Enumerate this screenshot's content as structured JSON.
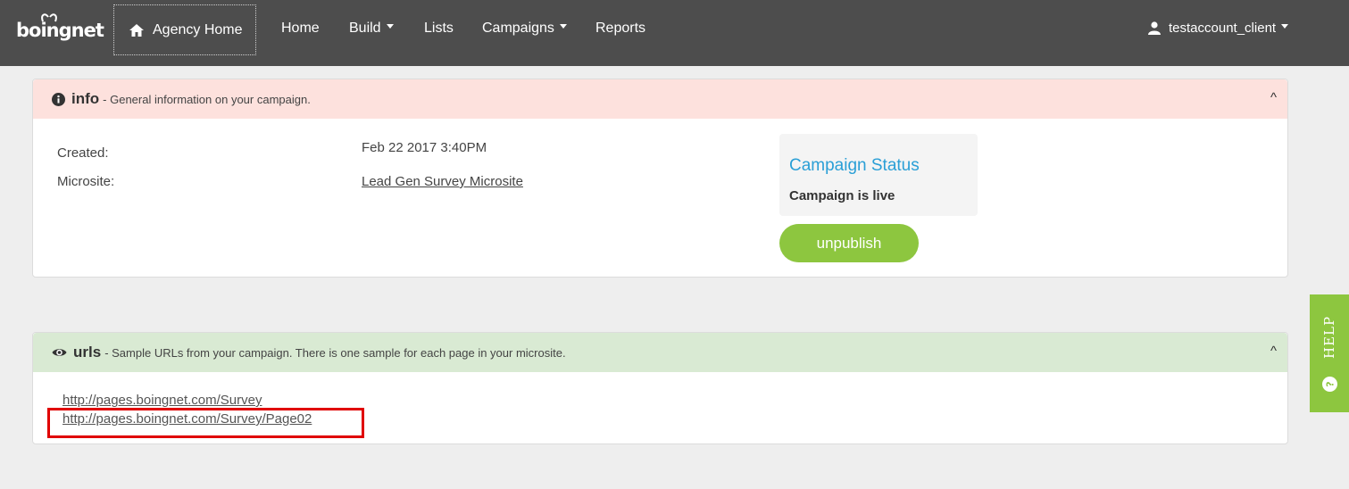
{
  "header": {
    "logo_text": "boingnet",
    "agency_home": "Agency Home",
    "nav": [
      {
        "label": "Home",
        "dropdown": false
      },
      {
        "label": "Build",
        "dropdown": true
      },
      {
        "label": "Lists",
        "dropdown": false
      },
      {
        "label": "Campaigns",
        "dropdown": true
      },
      {
        "label": "Reports",
        "dropdown": false
      }
    ],
    "user": "testaccount_client"
  },
  "info_panel": {
    "title": "info",
    "description": "- General information on your campaign.",
    "collapse": "^",
    "fields": [
      {
        "label": "Created:",
        "value": "Feb 22 2017 3:40PM"
      },
      {
        "label": "Microsite:",
        "value": "Lead Gen Survey Microsite"
      }
    ],
    "status": {
      "title": "Campaign Status",
      "text": "Campaign is live",
      "button": "unpublish"
    }
  },
  "urls_panel": {
    "title": "urls",
    "description": "- Sample URLs from your campaign. There is one sample for each page in your microsite.",
    "collapse": "^",
    "urls": [
      "http://pages.boingnet.com/Survey",
      "http://pages.boingnet.com/Survey/Page02"
    ]
  },
  "help": {
    "label": "HELP"
  },
  "colors": {
    "nav_bg": "#4d4d4d",
    "info_header": "#fde1dd",
    "urls_header": "#d9ead3",
    "accent_green": "#8dc63f",
    "status_blue": "#2a9fd6",
    "highlight_red": "#e00000"
  }
}
